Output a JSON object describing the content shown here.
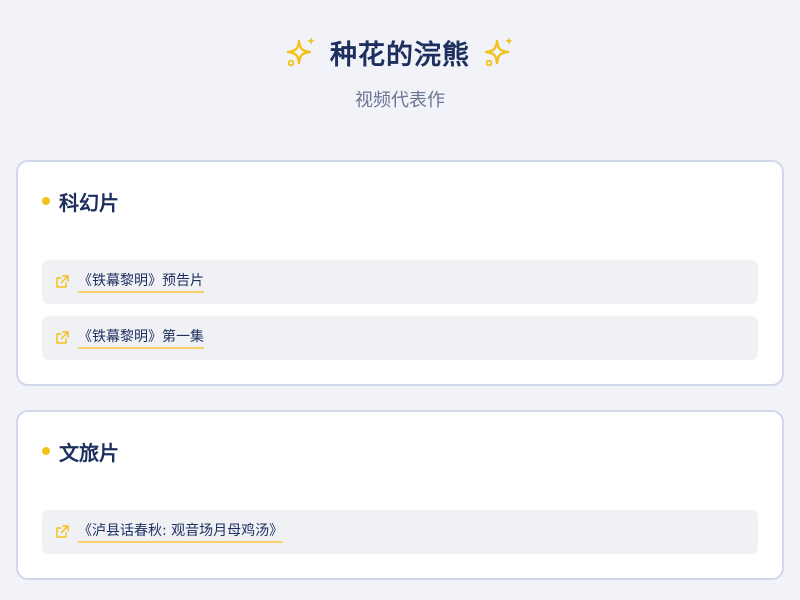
{
  "header": {
    "title": "种花的浣熊",
    "subtitle": "视频代表作",
    "left_icon": "sparkles-icon",
    "right_icon": "sparkles-icon"
  },
  "colors": {
    "accent": "#f2c21b",
    "title": "#1d2f5e",
    "subtitle": "#6a7591",
    "card_border": "#cfd7e8",
    "item_bg": "#eff1f5"
  },
  "sections": [
    {
      "title": "科幻片",
      "items": [
        {
          "label": "《铁幕黎明》预告片",
          "icon": "external-link-icon"
        },
        {
          "label": "《铁幕黎明》第一集",
          "icon": "external-link-icon"
        }
      ]
    },
    {
      "title": "文旅片",
      "items": [
        {
          "label": "《泸县话春秋: 观音场月母鸡汤》",
          "icon": "external-link-icon"
        }
      ]
    }
  ]
}
